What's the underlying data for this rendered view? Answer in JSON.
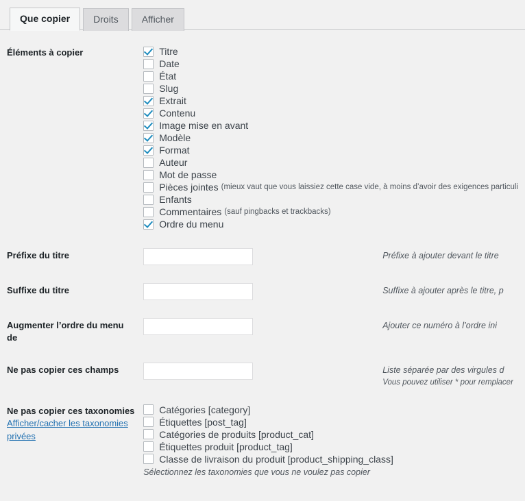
{
  "tabs": [
    {
      "label": "Que copier",
      "active": true
    },
    {
      "label": "Droits",
      "active": false
    },
    {
      "label": "Afficher",
      "active": false
    }
  ],
  "sections": {
    "elements": {
      "label": "Éléments à copier",
      "items": [
        {
          "label": "Titre",
          "checked": true,
          "note": ""
        },
        {
          "label": "Date",
          "checked": false,
          "note": ""
        },
        {
          "label": "État",
          "checked": false,
          "note": ""
        },
        {
          "label": "Slug",
          "checked": false,
          "note": ""
        },
        {
          "label": "Extrait",
          "checked": true,
          "note": ""
        },
        {
          "label": "Contenu",
          "checked": true,
          "note": ""
        },
        {
          "label": "Image mise en avant",
          "checked": true,
          "note": ""
        },
        {
          "label": "Modèle",
          "checked": true,
          "note": ""
        },
        {
          "label": "Format",
          "checked": true,
          "note": ""
        },
        {
          "label": "Auteur",
          "checked": false,
          "note": ""
        },
        {
          "label": "Mot de passe",
          "checked": false,
          "note": ""
        },
        {
          "label": "Pièces jointes",
          "checked": false,
          "note": "(mieux vaut que vous laissiez cette case vide, à moins d’avoir des exigences particuli"
        },
        {
          "label": "Enfants",
          "checked": false,
          "note": ""
        },
        {
          "label": "Commentaires",
          "checked": false,
          "note": "(sauf pingbacks et trackbacks)"
        },
        {
          "label": "Ordre du menu",
          "checked": true,
          "note": ""
        }
      ]
    },
    "title_prefix": {
      "label": "Préfixe du titre",
      "value": "",
      "placeholder": "",
      "desc": "Préfixe à ajouter devant le titre"
    },
    "title_suffix": {
      "label": "Suffixe du titre",
      "value": "",
      "placeholder": "",
      "desc": "Suffixe à ajouter après le titre, p"
    },
    "menu_order": {
      "label": "Augmenter l’ordre du menu de",
      "value": "",
      "placeholder": "",
      "desc": "Ajouter ce numéro à l’ordre ini"
    },
    "skip_fields": {
      "label": "Ne pas copier ces champs",
      "value": "",
      "placeholder": "",
      "desc": "Liste séparée par des virgules d",
      "desc2": "Vous pouvez utiliser * pour remplacer"
    },
    "taxonomies": {
      "label": "Ne pas copier ces taxonomies",
      "link": "Afficher/cacher les taxonomies privées",
      "items": [
        {
          "label": "Catégories [category]",
          "checked": false
        },
        {
          "label": "Étiquettes [post_tag]",
          "checked": false
        },
        {
          "label": "Catégories de produits [product_cat]",
          "checked": false
        },
        {
          "label": "Étiquettes produit [product_tag]",
          "checked": false
        },
        {
          "label": "Classe de livraison du produit [product_shipping_class]",
          "checked": false
        }
      ],
      "note": "Sélectionnez les taxonomies que vous ne voulez pas copier"
    }
  }
}
